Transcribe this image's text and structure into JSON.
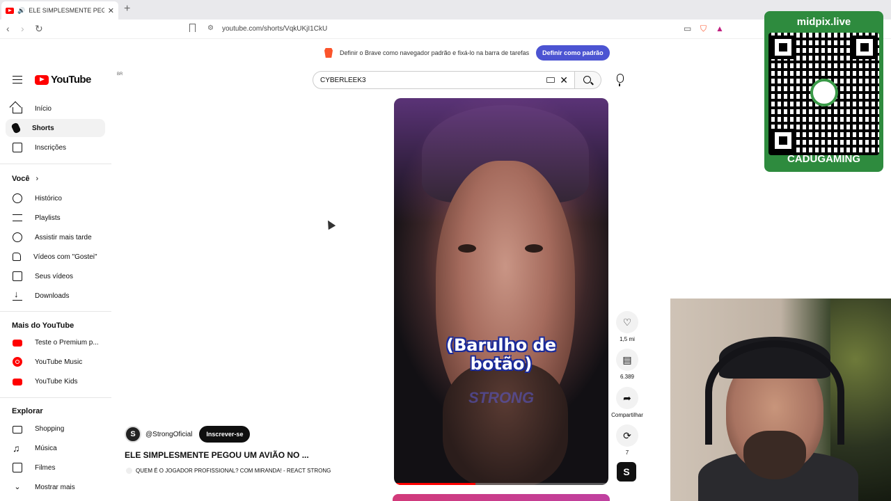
{
  "browser": {
    "tab_title": "ELE SIMPLESMENTE PEGOU UM AVIÃO NO ...",
    "url": "youtube.com/shorts/VqkUKjI1CkU"
  },
  "banner": {
    "text": "Definir o Brave como navegador padrão e fixá-lo na barra de tarefas",
    "button": "Definir como padrão"
  },
  "header": {
    "logo_text": "YouTube",
    "country_code": "BR",
    "search_value": "CYBERLEEK3"
  },
  "sidebar": {
    "main": [
      {
        "label": "Início",
        "icon": "home-icon"
      },
      {
        "label": "Shorts",
        "icon": "shorts-icon",
        "active": true
      },
      {
        "label": "Inscrições",
        "icon": "subscriptions-icon"
      }
    ],
    "you_heading": "Você",
    "you_items": [
      {
        "label": "Histórico",
        "icon": "history-icon"
      },
      {
        "label": "Playlists",
        "icon": "playlists-icon"
      },
      {
        "label": "Assistir mais tarde",
        "icon": "watch-later-icon"
      },
      {
        "label": "Vídeos com \"Gostei\"",
        "icon": "liked-icon"
      },
      {
        "label": "Seus vídeos",
        "icon": "your-videos-icon"
      },
      {
        "label": "Downloads",
        "icon": "download-icon"
      }
    ],
    "more_heading": "Mais do YouTube",
    "more_items": [
      {
        "label": "Teste o Premium p...",
        "icon": "premium-icon"
      },
      {
        "label": "YouTube Music",
        "icon": "music-icon"
      },
      {
        "label": "YouTube Kids",
        "icon": "kids-icon"
      }
    ],
    "explore_heading": "Explorar",
    "explore_items": [
      {
        "label": "Shopping",
        "icon": "shopping-icon"
      },
      {
        "label": "Música",
        "icon": "music-note-icon"
      },
      {
        "label": "Filmes",
        "icon": "film-icon"
      },
      {
        "label": "Mostrar mais",
        "icon": "chevron-down-icon"
      }
    ]
  },
  "video": {
    "caption": "(Barulho de botão)",
    "watermark": "STRONG",
    "progress": 0.38,
    "channel": "@StrongOficial",
    "subscribe": "Inscrever-se",
    "title": "ELE SIMPLESMENTE PEGOU UM AVIÃO NO ...",
    "subtitle": "QUEM É O JOGADOR PROFISSIONAL? COM MIRANDA! - REACT STRONG"
  },
  "actions": {
    "likes": "1,5 mi",
    "comments": "6.389",
    "share": "Compartilhar",
    "remix": "7"
  },
  "overlay": {
    "site": "midpix.live",
    "name": "CADUGAMING"
  },
  "colors": {
    "youtube_red": "#ff0000",
    "brave_button": "#4c54d2",
    "qr_green": "#2e8b3e"
  }
}
